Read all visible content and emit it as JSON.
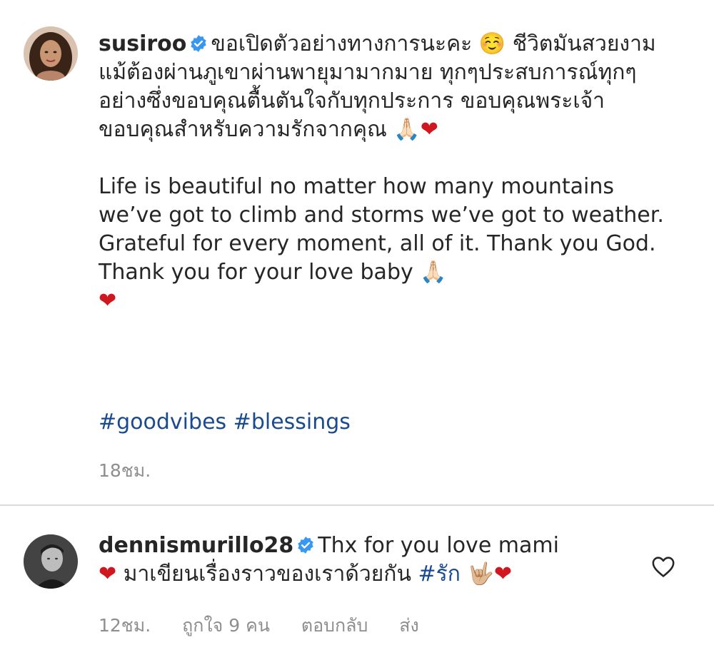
{
  "post": {
    "username": "susiroo",
    "caption_thai": "ขอเปิดตัวอย่างทางการนะคะ ☺️ ชีวิตมันสวยงามแม้ต้องผ่านภูเขาผ่านพายุมามากมาย ทุกๆประสบการณ์ทุกๆอย่างซึ่งขอบคุณตื้นตันใจกับทุกประการ ขอบคุณพระเจ้า ขอบคุณสำหรับความรักจากคุณ 🙏🏻",
    "heart": "❤",
    "caption_english": "Life is beautiful no matter how many mountains we’ve got to climb and storms we’ve got to weather. Grateful for every moment, all of it. Thank you God. Thank you for your love baby 🙏🏻",
    "hashtags": "#goodvibes #blessings",
    "timestamp": "18ชม."
  },
  "comment": {
    "username": "dennismurillo28",
    "text_1": "Thx for you love mami",
    "heart": "❤",
    "text_2": "มาเขียนเรื่องราวของเราด้วยกัน",
    "hashtag": "#รัก",
    "emoji_end": "🤟🏼",
    "heart_end": "❤",
    "timestamp": "12ชม.",
    "likes": "ถูกใจ 9 คน",
    "reply": "ตอบกลับ",
    "send": "ส่ง"
  },
  "colors": {
    "text": "#262626",
    "meta": "#8e8e8e",
    "hashtag": "#1a4a8f",
    "verified": "#3897f0",
    "heart": "#d0161e",
    "divider": "#dbdbdb"
  },
  "icons": {
    "verified": "verified-badge-icon",
    "like": "heart-outline-icon"
  }
}
